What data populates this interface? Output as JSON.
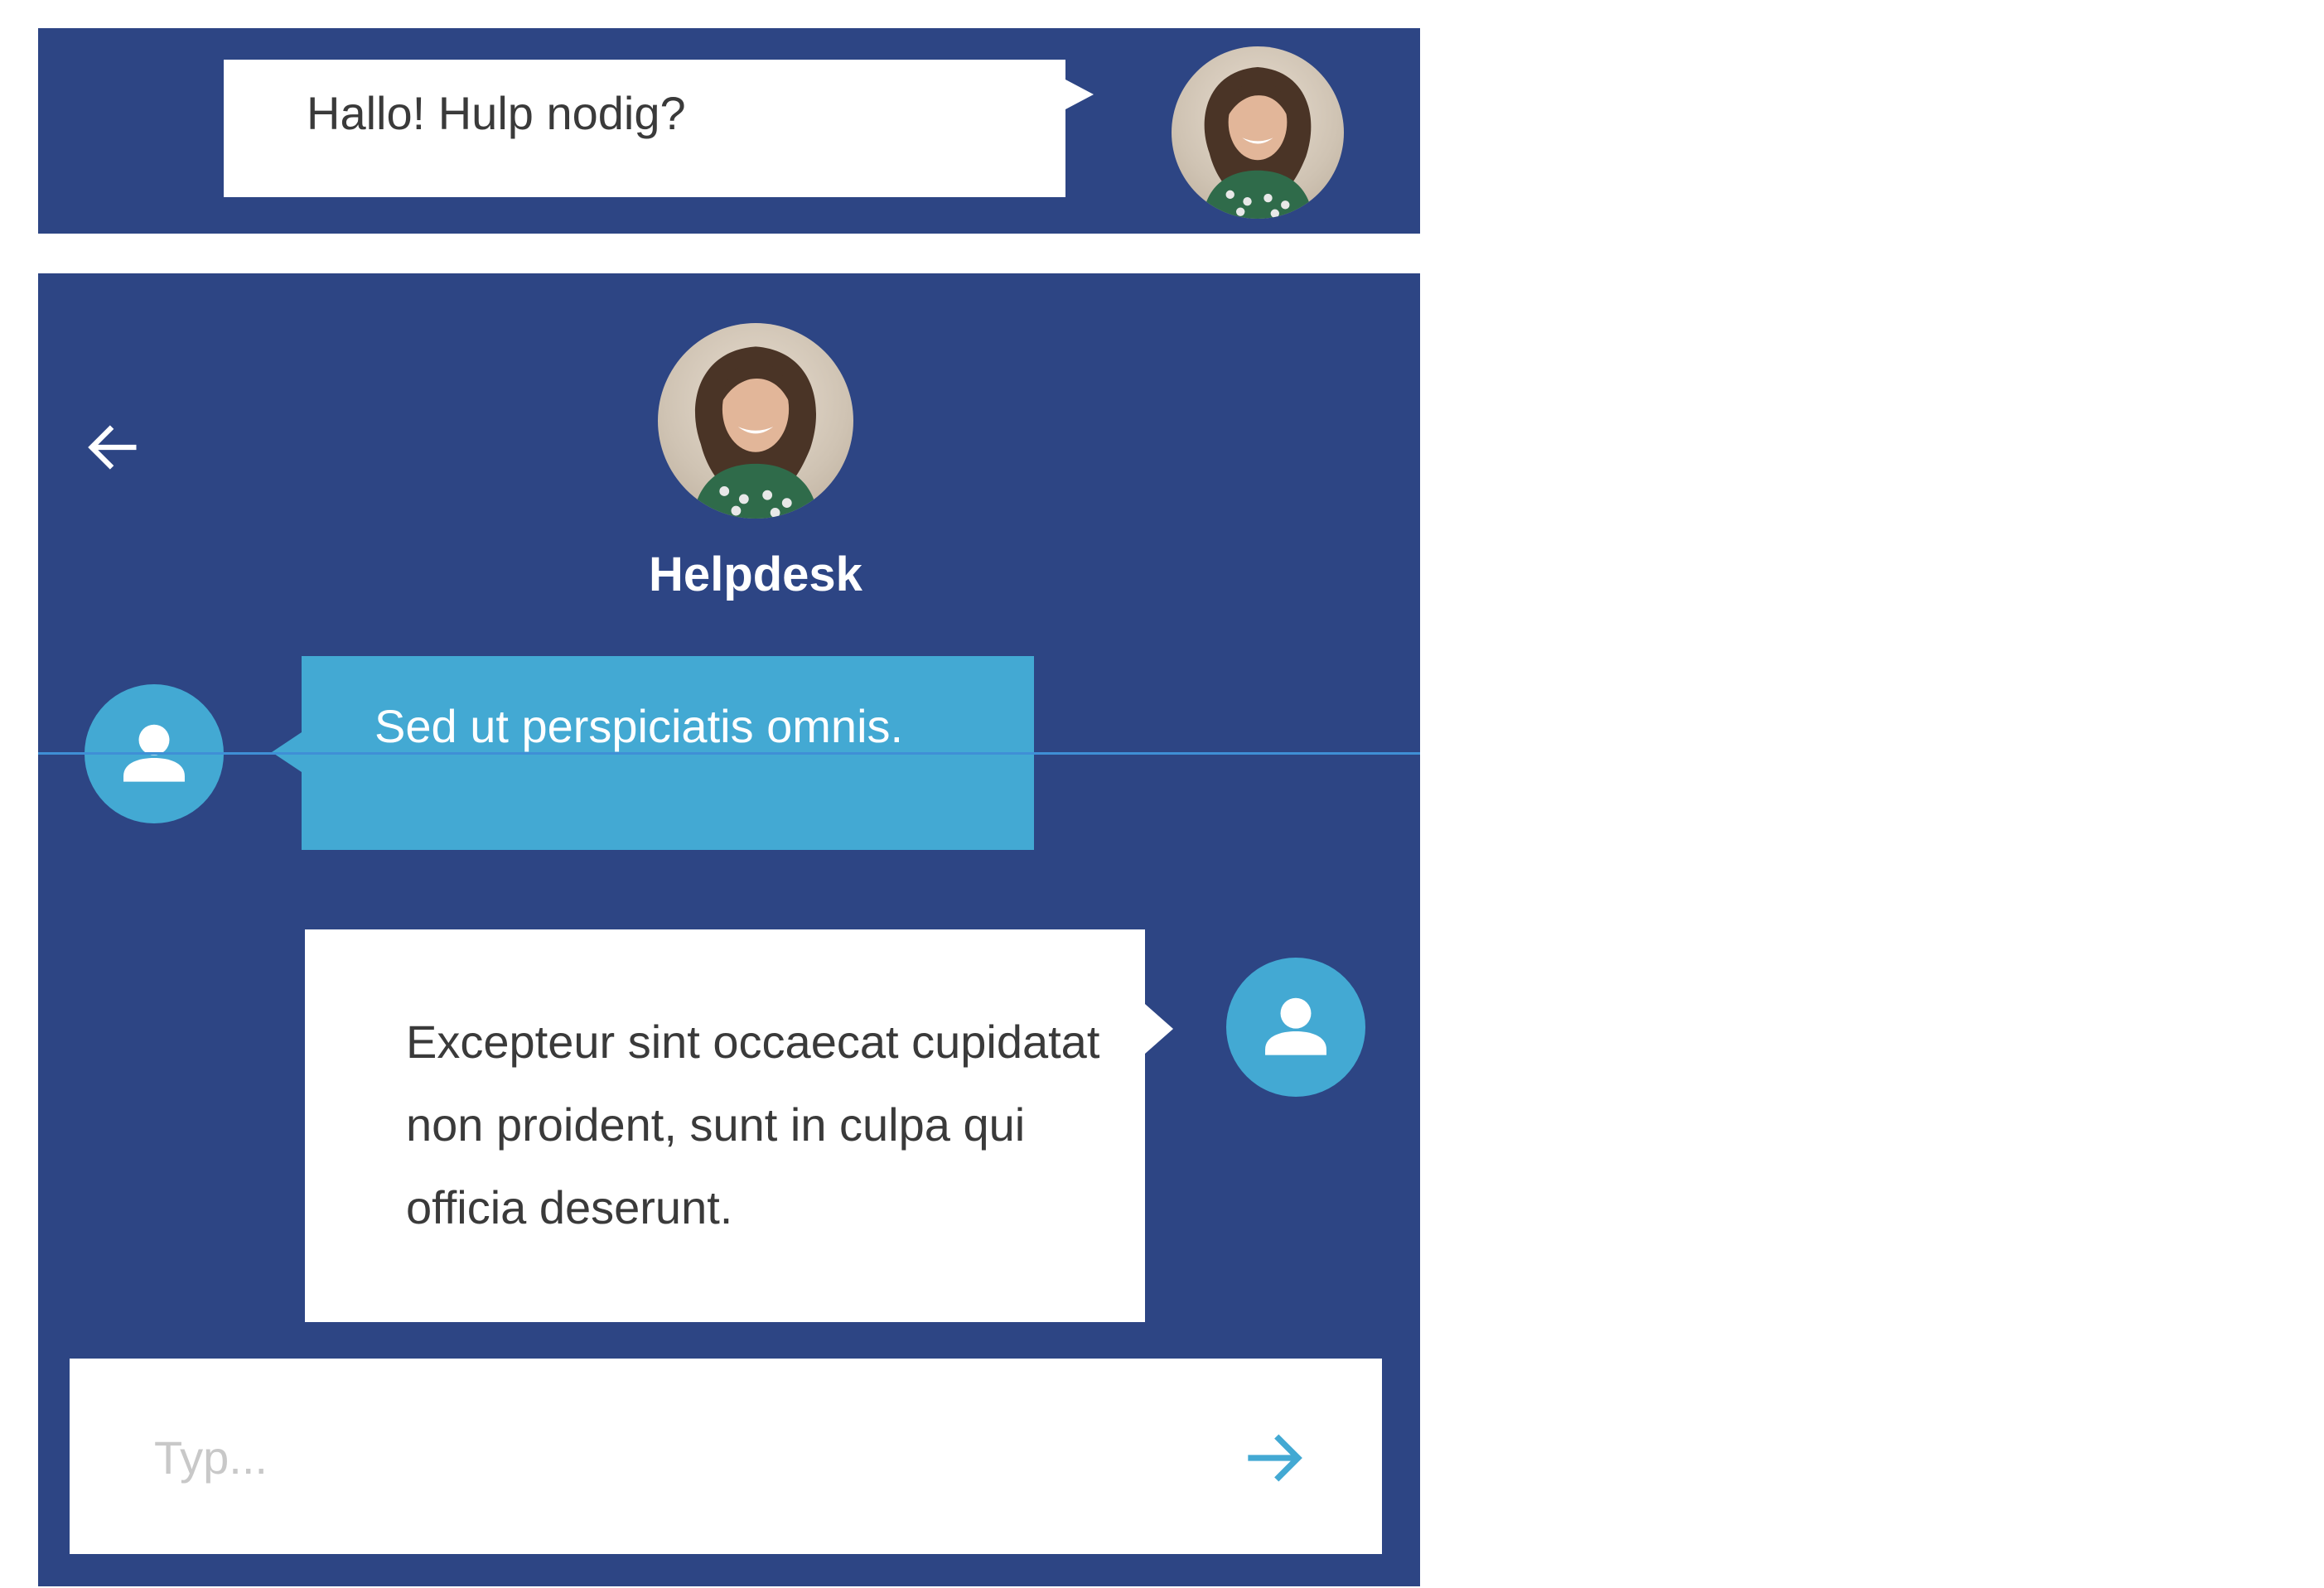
{
  "colors": {
    "panel_background": "#2d4584",
    "accent": "#43a9d3",
    "bubble_white": "#ffffff",
    "text_dark": "#3a3a3a",
    "divider": "#3f8fd6",
    "placeholder": "#c8c8c8"
  },
  "teaser": {
    "greeting": "Hallo! Hulp nodig?",
    "avatar_icon": "agent-photo-avatar"
  },
  "chat": {
    "back_icon": "arrow-left-icon",
    "agent_avatar_icon": "agent-photo-avatar",
    "agent_name": "Helpdesk",
    "messages": [
      {
        "sender": "agent",
        "avatar_icon": "user-icon",
        "text": "Sed ut perspiciatis omnis."
      },
      {
        "sender": "user",
        "avatar_icon": "user-icon",
        "text": "Excepteur sint occaecat cupidatat non proident, sunt in culpa qui officia deserunt."
      }
    ],
    "composer": {
      "value": "",
      "placeholder": "Typ...",
      "send_icon": "arrow-right-icon"
    }
  }
}
